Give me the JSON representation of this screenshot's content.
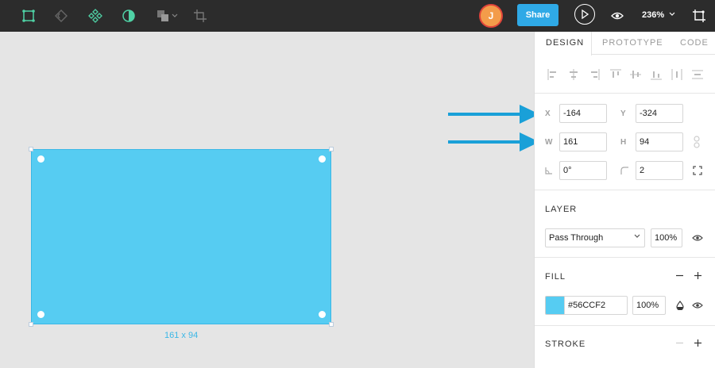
{
  "toolbar": {
    "tools": [
      {
        "name": "frame-tool-icon"
      },
      {
        "name": "component-swap-icon"
      },
      {
        "name": "components-icon"
      },
      {
        "name": "contrast-icon"
      },
      {
        "name": "boolean-group-icon"
      },
      {
        "name": "crop-icon"
      }
    ],
    "avatar_initial": "J",
    "share_label": "Share",
    "zoom_level": "236%"
  },
  "canvas": {
    "shape_fill": "#56CCF2",
    "dimension_label": "161 x 94"
  },
  "panel": {
    "tabs": [
      {
        "label": "DESIGN",
        "active": true
      },
      {
        "label": "PROTOTYPE",
        "active": false
      },
      {
        "label": "CODE",
        "active": false
      }
    ],
    "position": {
      "x_label": "X",
      "x_value": "-164",
      "y_label": "Y",
      "y_value": "-324",
      "w_label": "W",
      "w_value": "161",
      "h_label": "H",
      "h_value": "94",
      "rotation_value": "0°",
      "radius_value": "2"
    },
    "layer": {
      "title": "LAYER",
      "blend_mode": "Pass Through",
      "opacity": "100%"
    },
    "fill": {
      "title": "FILL",
      "color_hex": "#56CCF2",
      "opacity": "100%"
    },
    "stroke": {
      "title": "STROKE"
    }
  },
  "colors": {
    "accent": "#2FA9E6",
    "toolbar_bg": "#2C2C2C",
    "arrow": "#1AA0D8"
  }
}
